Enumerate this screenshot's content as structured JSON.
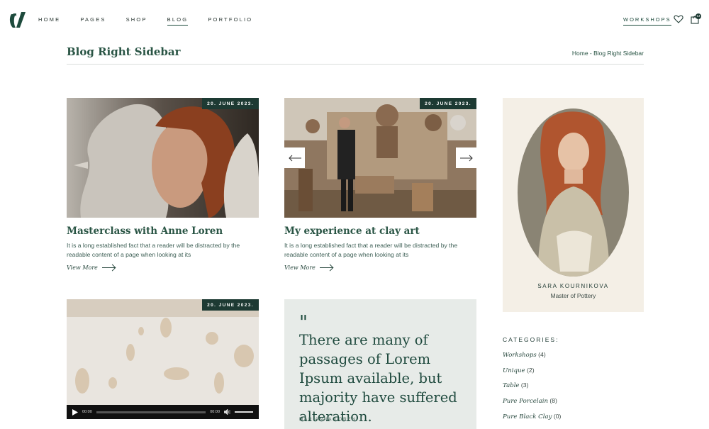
{
  "header": {
    "nav": [
      "HOME",
      "PAGES",
      "SHOP",
      "BLOG",
      "PORTFOLIO"
    ],
    "active": "BLOG",
    "workshops": "WORKSHOPS",
    "cart_count": "14"
  },
  "page": {
    "title": "Blog Right Sidebar",
    "breadcrumb": "Home - Blog Right Sidebar"
  },
  "posts": [
    {
      "date": "20. JUNE 2023.",
      "title": "Masterclass with Anne Loren",
      "excerpt": "It is a long established fact that a reader will be distracted by the readable content of a page when looking at its",
      "more": "View More"
    },
    {
      "date": "20. JUNE 2023.",
      "title": "My experience at clay art",
      "excerpt": "It is a long established fact that a reader will be distracted by the readable content of a page when looking at its",
      "more": "View More"
    },
    {
      "date": "20. JUNE 2023.",
      "audio_time": "00:00",
      "audio_total": "00:00"
    }
  ],
  "quote": {
    "mark": "\"",
    "text": "There are many of passages of Lorem Ipsum available, but majority have suffered alteration.",
    "author": "MARIANNA LOREN"
  },
  "sidebar": {
    "name": "SARA KOURNIKOVA",
    "role": "Master of Pottery",
    "categories_title": "CATEGORIES:",
    "categories": [
      {
        "name": "Workshops",
        "count": "(4)"
      },
      {
        "name": "Unique",
        "count": "(2)"
      },
      {
        "name": "Table",
        "count": "(3)"
      },
      {
        "name": "Pure Porcelain",
        "count": "(8)"
      },
      {
        "name": "Pure Black Clay",
        "count": "(0)"
      }
    ]
  },
  "colors": {
    "brand": "#1d3a33",
    "accent": "#2a5545",
    "quote_bg": "#e7ebe8",
    "profile_bg": "#f4efe6"
  }
}
